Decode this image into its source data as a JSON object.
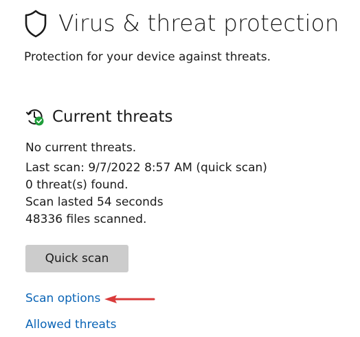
{
  "header": {
    "title": "Virus & threat protection",
    "subtitle": "Protection for your device against threats.",
    "icon": "shield-icon"
  },
  "current_threats": {
    "title": "Current threats",
    "icon": "history-check-icon",
    "status": "No current threats.",
    "details": [
      "Last scan: 9/7/2022 8:57 AM (quick scan)",
      "0 threat(s) found.",
      "Scan lasted 54 seconds",
      "48336 files scanned."
    ],
    "quick_scan_label": "Quick scan"
  },
  "links": {
    "scan_options": "Scan options",
    "allowed_threats": "Allowed threats"
  },
  "annotation": {
    "icon": "red-arrow-icon",
    "color": "#d93a3a"
  },
  "colors": {
    "link": "#0a64b6",
    "button_bg": "#cccccc",
    "status_ok": "#1f9d3a"
  }
}
